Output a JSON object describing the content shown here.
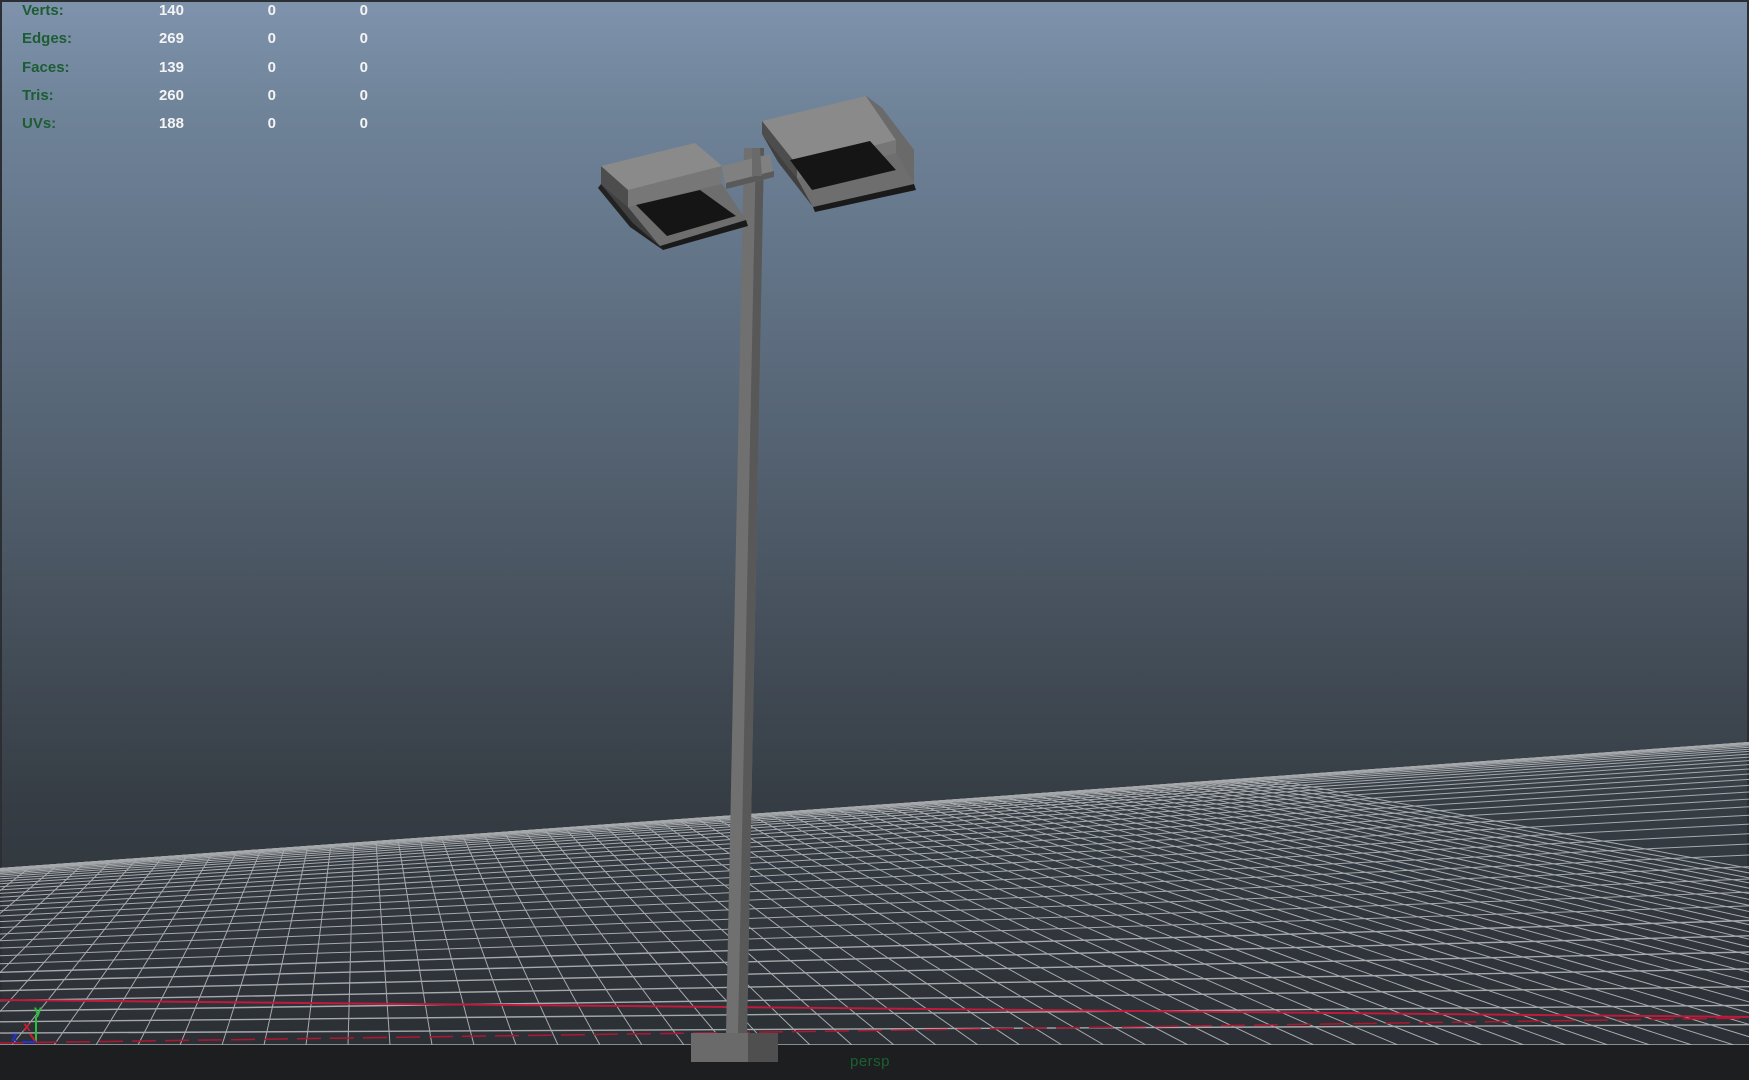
{
  "viewport": {
    "camera_label": "persp"
  },
  "hud": {
    "rows": [
      {
        "label": "Verts:",
        "v1": "140",
        "v2": "0",
        "v3": "0"
      },
      {
        "label": "Edges:",
        "v1": "269",
        "v2": "0",
        "v3": "0"
      },
      {
        "label": "Faces:",
        "v1": "139",
        "v2": "0",
        "v3": "0"
      },
      {
        "label": "Tris:",
        "v1": "260",
        "v2": "0",
        "v3": "0"
      },
      {
        "label": "UVs:",
        "v1": "188",
        "v2": "0",
        "v3": "0"
      }
    ]
  },
  "axis_gizmo": {
    "x_label": "x",
    "y_label": "y",
    "z_label": "z",
    "x_color": "#d0192b",
    "y_color": "#27c23a",
    "z_color": "#2230d6"
  },
  "colors": {
    "hud_label": "#1d5d33",
    "hud_value": "#f4f4f4",
    "grid_line": "#a7aaad",
    "axis_line": "#c01a3c",
    "model_gray": "#7b7b7b"
  }
}
